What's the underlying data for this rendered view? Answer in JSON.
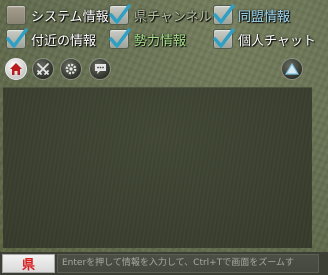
{
  "filters": [
    {
      "label": "システム情報",
      "checked": false
    },
    {
      "label": "県チャンネル",
      "checked": true
    },
    {
      "label": "同盟情報",
      "checked": true
    },
    {
      "label": "付近の情報",
      "checked": true
    },
    {
      "label": "勢力情報",
      "checked": true
    },
    {
      "label": "個人チャット",
      "checked": true
    }
  ],
  "iconbar": {
    "home": "home-icon",
    "battle": "crossed-swords-icon",
    "settings": "gear-icon",
    "chat": "speech-bubble-icon",
    "scroll_up": "triangle-up-icon"
  },
  "input": {
    "channel_label": "県",
    "placeholder": "Enterを押して情報を入力して、Ctrl+Tで画面をズームす"
  },
  "colors": {
    "channel_text": "#d81e1e",
    "label_blue": "#9fd8f2",
    "label_green": "#a8e08c"
  }
}
